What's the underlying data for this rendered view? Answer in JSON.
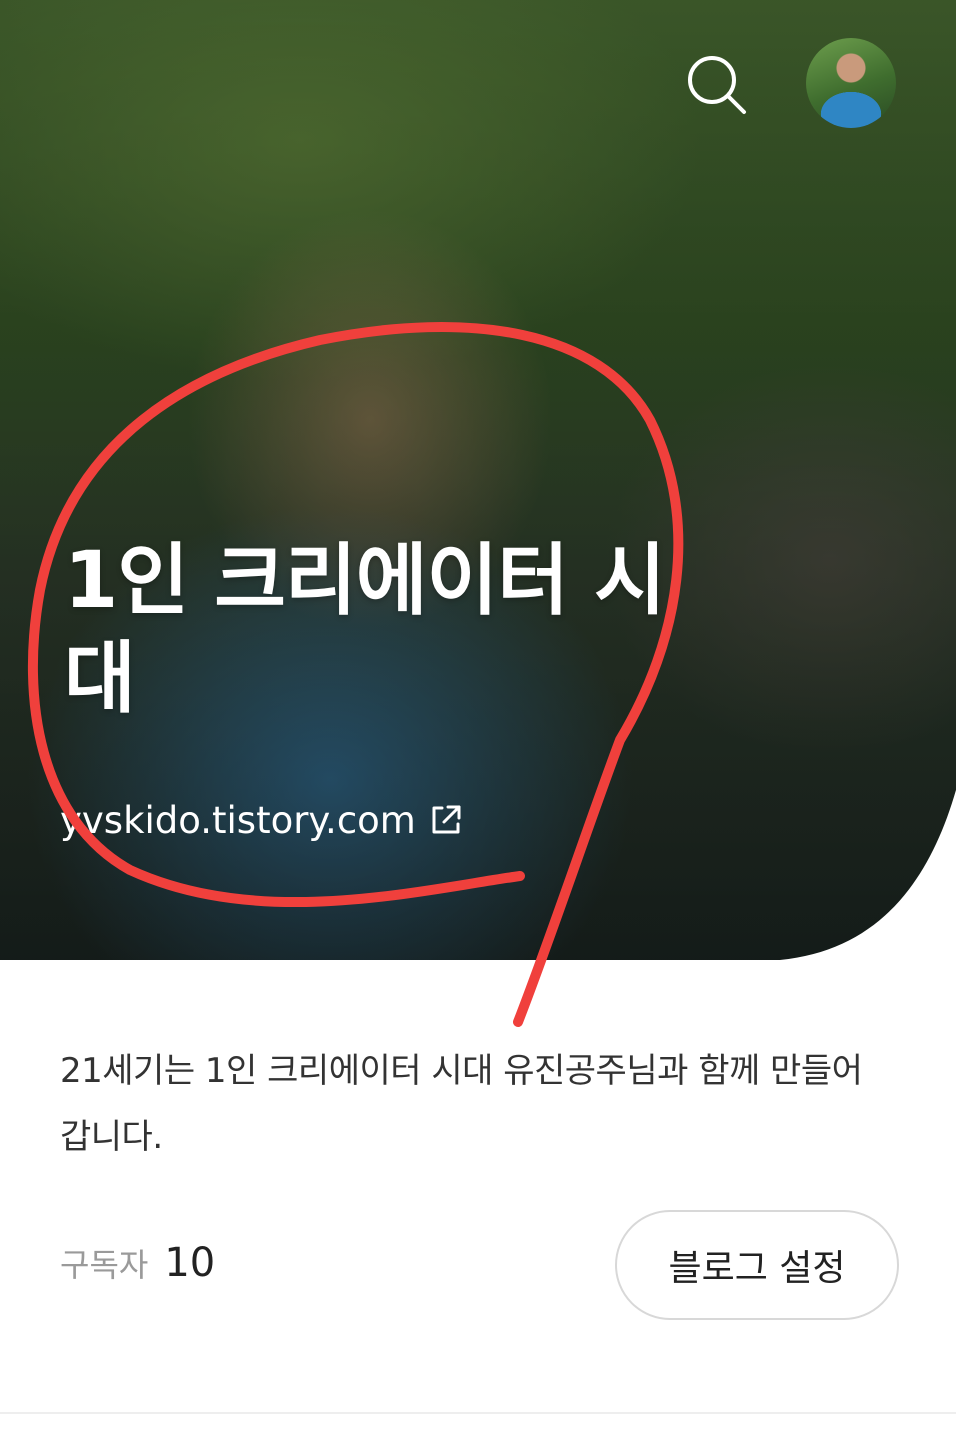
{
  "header": {
    "search_icon": "search-icon",
    "avatar_icon": "profile-avatar"
  },
  "hero": {
    "title": "1인 크리에이터 시대",
    "url": "yvskido.tistory.com",
    "url_icon": "external-link-icon"
  },
  "profile": {
    "description": "21세기는 1인 크리에이터 시대 유진공주님과 함께 만들어 갑니다.",
    "subscribers_label": "구독자",
    "subscribers_count": "10",
    "settings_button": "블로그 설정"
  },
  "colors": {
    "annotation_stroke": "#f0403c",
    "text_primary": "#333333",
    "text_muted": "#9a9a9a",
    "button_border": "#d8d8d8"
  }
}
